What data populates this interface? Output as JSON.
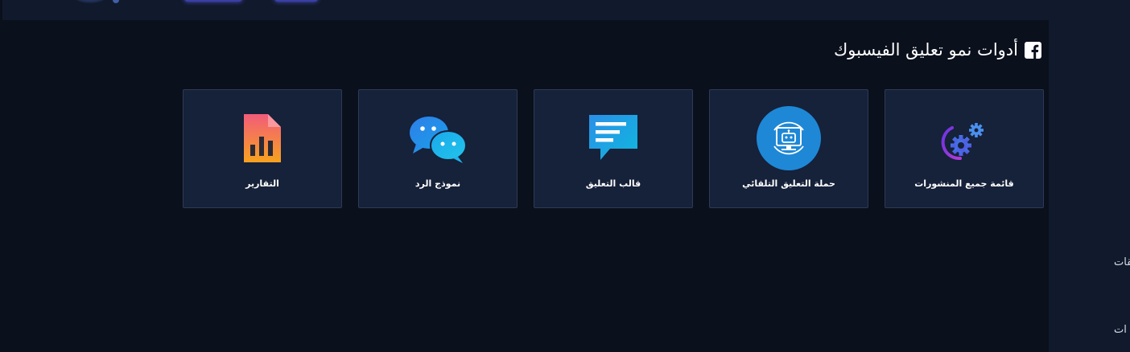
{
  "page": {
    "title": "أدوات نمو تعليق الفيسبوك"
  },
  "sidebar": {
    "items": [
      {
        "label": "تطبيقات"
      },
      {
        "label": "ات"
      }
    ]
  },
  "tools": [
    {
      "label": "قائمة جميع المنشورات",
      "icon": "gears-icon"
    },
    {
      "label": "حملة التعليق التلقائي",
      "icon": "robot-icon"
    },
    {
      "label": "قالب التعليق",
      "icon": "comment-template-icon"
    },
    {
      "label": "نموذج الرد",
      "icon": "chat-bubbles-icon"
    },
    {
      "label": "التقارير",
      "icon": "report-icon"
    }
  ],
  "colors": {
    "background": "#0a101c",
    "card": "#16213a",
    "card_border": "#2e3a56",
    "topbar": "#111a2c",
    "accent_blue": "#1e88d6",
    "accent_purple": "#7b3fe4"
  }
}
